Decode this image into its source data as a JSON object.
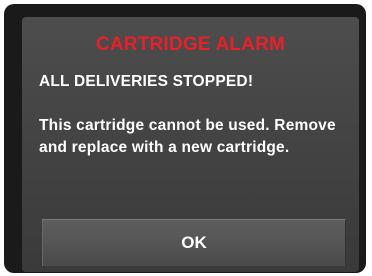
{
  "alarm": {
    "title": "CARTRIDGE ALARM",
    "subtitle": "ALL DELIVERIES STOPPED!",
    "message": "This cartridge cannot be used. Remove and replace with a new cartridge.",
    "ok_label": "OK"
  },
  "colors": {
    "title": "#e8202a",
    "text": "#ffffff",
    "screen_background": "#454545",
    "frame": "#1a1a1a"
  }
}
